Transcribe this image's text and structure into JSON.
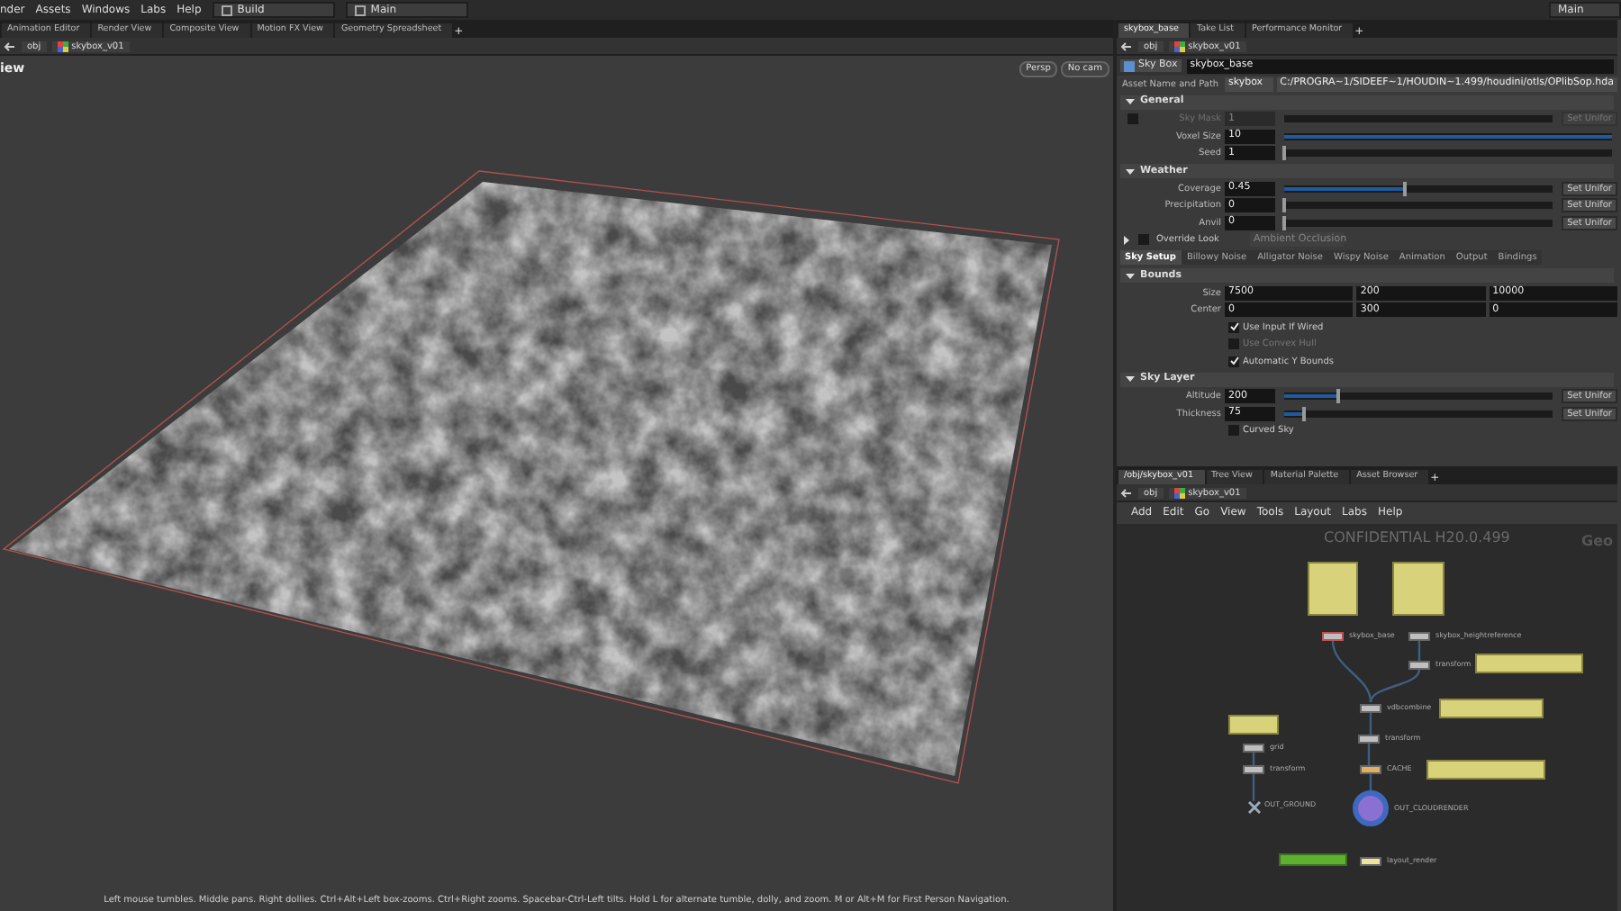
{
  "menu_bar": {
    "items": [
      "nder",
      "Assets",
      "Windows",
      "Labs",
      "Help"
    ],
    "desktops": [
      "Build",
      "Main"
    ],
    "right_label": "Main"
  },
  "left_pane": {
    "tabs": [
      {
        "label": "Animation Editor",
        "selected": false
      },
      {
        "label": "Render View",
        "selected": false
      },
      {
        "label": "Composite View",
        "selected": false
      },
      {
        "label": "Motion FX View",
        "selected": false
      },
      {
        "label": "Geometry Spreadsheet",
        "selected": false
      }
    ],
    "add_tab": "+",
    "path": [
      "obj",
      "skybox_v01"
    ],
    "viewport": {
      "title": "iew",
      "camera_buttons": [
        "Persp",
        "No cam"
      ],
      "hint": "Left mouse tumbles. Middle pans. Right dollies. Ctrl+Alt+Left box-zooms. Ctrl+Right zooms. Spacebar-Ctrl-Left tilts. Hold L for alternate tumble, dolly, and zoom. M or Alt+M for First Person Navigation."
    }
  },
  "parameter_pane": {
    "tabs": [
      {
        "label": "skybox_base",
        "selected": true
      },
      {
        "label": "Take List",
        "selected": false
      },
      {
        "label": "Performance Monitor",
        "selected": false
      }
    ],
    "add_tab": "+",
    "path": [
      "obj",
      "skybox_v01"
    ],
    "node_type": "Sky Box",
    "node_name": "skybox_base",
    "asset_label": "Asset Name and Path",
    "asset_name": "skybox",
    "asset_path": "C:/PROGRA~1/SIDEEF~1/HOUDIN~1.499/houdini/otls/OPlibSop.hda",
    "sections": [
      {
        "title": "General",
        "expanded": true,
        "rows": [
          {
            "kind": "toggle_slider",
            "label": "Sky Mask",
            "value": "1",
            "checked": false,
            "disabled": true,
            "button": "Set Unifor"
          },
          {
            "kind": "slider",
            "label": "Voxel Size",
            "value": "10",
            "disabled": false,
            "level": 1
          },
          {
            "kind": "slider",
            "label": "Seed",
            "value": "1",
            "disabled": false,
            "level": 0
          }
        ]
      },
      {
        "title": "Weather",
        "expanded": true,
        "rows": [
          {
            "kind": "slider",
            "label": "Coverage",
            "value": "0.45",
            "disabled": false,
            "level": 0.45,
            "button": "Set Unifor"
          },
          {
            "kind": "slider",
            "label": "Precipitation",
            "value": "0",
            "disabled": false,
            "level": 0,
            "button": "Set Unifor"
          },
          {
            "kind": "slider",
            "label": "Anvil",
            "value": "0",
            "disabled": false,
            "level": 0,
            "button": "Set Unifor"
          }
        ]
      }
    ],
    "override": {
      "label": "Override Look",
      "checked": false,
      "expanded": false,
      "dropdown": "Ambient Occlusion"
    },
    "folder_tabs": [
      {
        "label": "Sky Setup",
        "selected": true
      },
      {
        "label": "Billowy Noise",
        "selected": false
      },
      {
        "label": "Alligator Noise",
        "selected": false
      },
      {
        "label": "Wispy Noise",
        "selected": false
      },
      {
        "label": "Animation",
        "selected": false
      },
      {
        "label": "Output",
        "selected": false
      },
      {
        "label": "Bindings",
        "selected": false
      }
    ],
    "tab_sections": [
      {
        "title": "Bounds",
        "expanded": true,
        "rows": [
          {
            "kind": "vector",
            "label": "Size",
            "values": [
              "7500",
              "200",
              "10000"
            ]
          },
          {
            "kind": "vector",
            "label": "Center",
            "values": [
              "0",
              "300",
              "0"
            ]
          },
          {
            "kind": "checkbox",
            "label": "Use Input If Wired",
            "checked": true,
            "disabled": false
          },
          {
            "kind": "checkbox",
            "label": "Use Convex Hull",
            "checked": false,
            "disabled": true
          },
          {
            "kind": "checkbox",
            "label": "Automatic Y Bounds",
            "checked": true,
            "disabled": false
          }
        ]
      },
      {
        "title": "Sky Layer",
        "expanded": true,
        "rows": [
          {
            "kind": "slider",
            "label": "Altitude",
            "value": "200",
            "disabled": false,
            "level": 0.2,
            "button": "Set Unifor"
          },
          {
            "kind": "slider",
            "label": "Thickness",
            "value": "75",
            "disabled": false,
            "level": 0.075,
            "button": "Set Unifor"
          },
          {
            "kind": "checkbox",
            "label": "Curved Sky",
            "checked": false,
            "disabled": false
          }
        ]
      }
    ]
  },
  "network_pane": {
    "tabs": [
      {
        "label": "/obj/skybox_v01",
        "selected": true
      },
      {
        "label": "Tree View",
        "selected": false
      },
      {
        "label": "Material Palette",
        "selected": false
      },
      {
        "label": "Asset Browser",
        "selected": false
      }
    ],
    "add_tab": "+",
    "path": [
      "obj",
      "skybox_v01"
    ],
    "menu": [
      "Add",
      "Edit",
      "Go",
      "View",
      "Tools",
      "Layout",
      "Labs",
      "Help"
    ],
    "watermark": "CONFIDENTIAL H20.0.499",
    "context_label": "Geo",
    "nodes": [
      {
        "kind": "note"
      },
      {
        "kind": "note"
      },
      {
        "kind": "node",
        "label": "skybox_base",
        "flagged": true
      },
      {
        "kind": "node",
        "label": "skybox_heightreference",
        "flagged": false
      },
      {
        "kind": "node",
        "label": "transform",
        "flagged": false
      },
      {
        "kind": "note"
      },
      {
        "kind": "node",
        "label": "vdbcombine",
        "flagged": false
      },
      {
        "kind": "note"
      },
      {
        "kind": "node",
        "label": "transform",
        "flagged": false
      },
      {
        "kind": "cache",
        "label": "CACHE"
      },
      {
        "kind": "note"
      },
      {
        "kind": "output",
        "label": "OUT_CLOUDRENDER"
      },
      {
        "kind": "note"
      },
      {
        "kind": "node",
        "label": "grid",
        "flagged": false
      },
      {
        "kind": "node",
        "label": "transform",
        "flagged": false
      },
      {
        "kind": "null",
        "label": "OUT_GROUND"
      },
      {
        "kind": "green_note"
      },
      {
        "kind": "rop",
        "label": "layout_render"
      }
    ]
  }
}
